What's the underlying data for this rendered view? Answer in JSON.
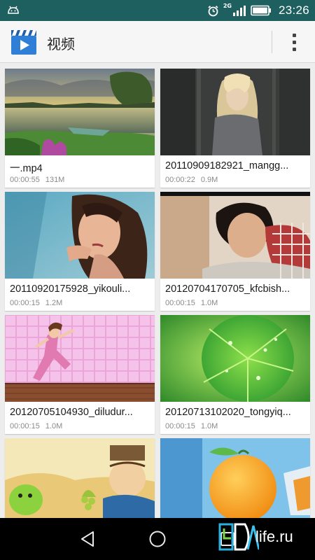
{
  "status_bar": {
    "time": "23:26",
    "network": "2G",
    "icons": [
      "android-debug-icon",
      "alarm-clock-icon",
      "signal-icon",
      "battery-icon"
    ]
  },
  "app_bar": {
    "title": "视频",
    "icon": "video-clapper-icon",
    "menu_icon": "overflow-menu-icon"
  },
  "videos": [
    {
      "name": "一.mp4",
      "duration": "00:00:55",
      "size": "131M"
    },
    {
      "name": "20110909182921_mangg...",
      "duration": "00:00:22",
      "size": "0.9M"
    },
    {
      "name": "20110920175928_yikouli...",
      "duration": "00:00:15",
      "size": "1.2M"
    },
    {
      "name": "20120704170705_kfcbish...",
      "duration": "00:00:15",
      "size": "1.0M"
    },
    {
      "name": "20120705104930_diludur...",
      "duration": "00:00:15",
      "size": "1.0M"
    },
    {
      "name": "20120713102020_tongyiq...",
      "duration": "00:00:15",
      "size": "1.0M"
    },
    {
      "name": "",
      "duration": "",
      "size": ""
    },
    {
      "name": "",
      "duration": "",
      "size": ""
    }
  ],
  "nav_bar": {
    "buttons": [
      "back-icon",
      "home-icon",
      "recents-icon"
    ]
  },
  "watermark": {
    "logo_text": "life.ru",
    "logo_mark": "4PDA"
  },
  "colors": {
    "status_bar": "#1e5f60",
    "app_bar": "#f6f6f6",
    "background": "#ededed",
    "card": "#ffffff",
    "meta_text": "#8a8a8a"
  }
}
